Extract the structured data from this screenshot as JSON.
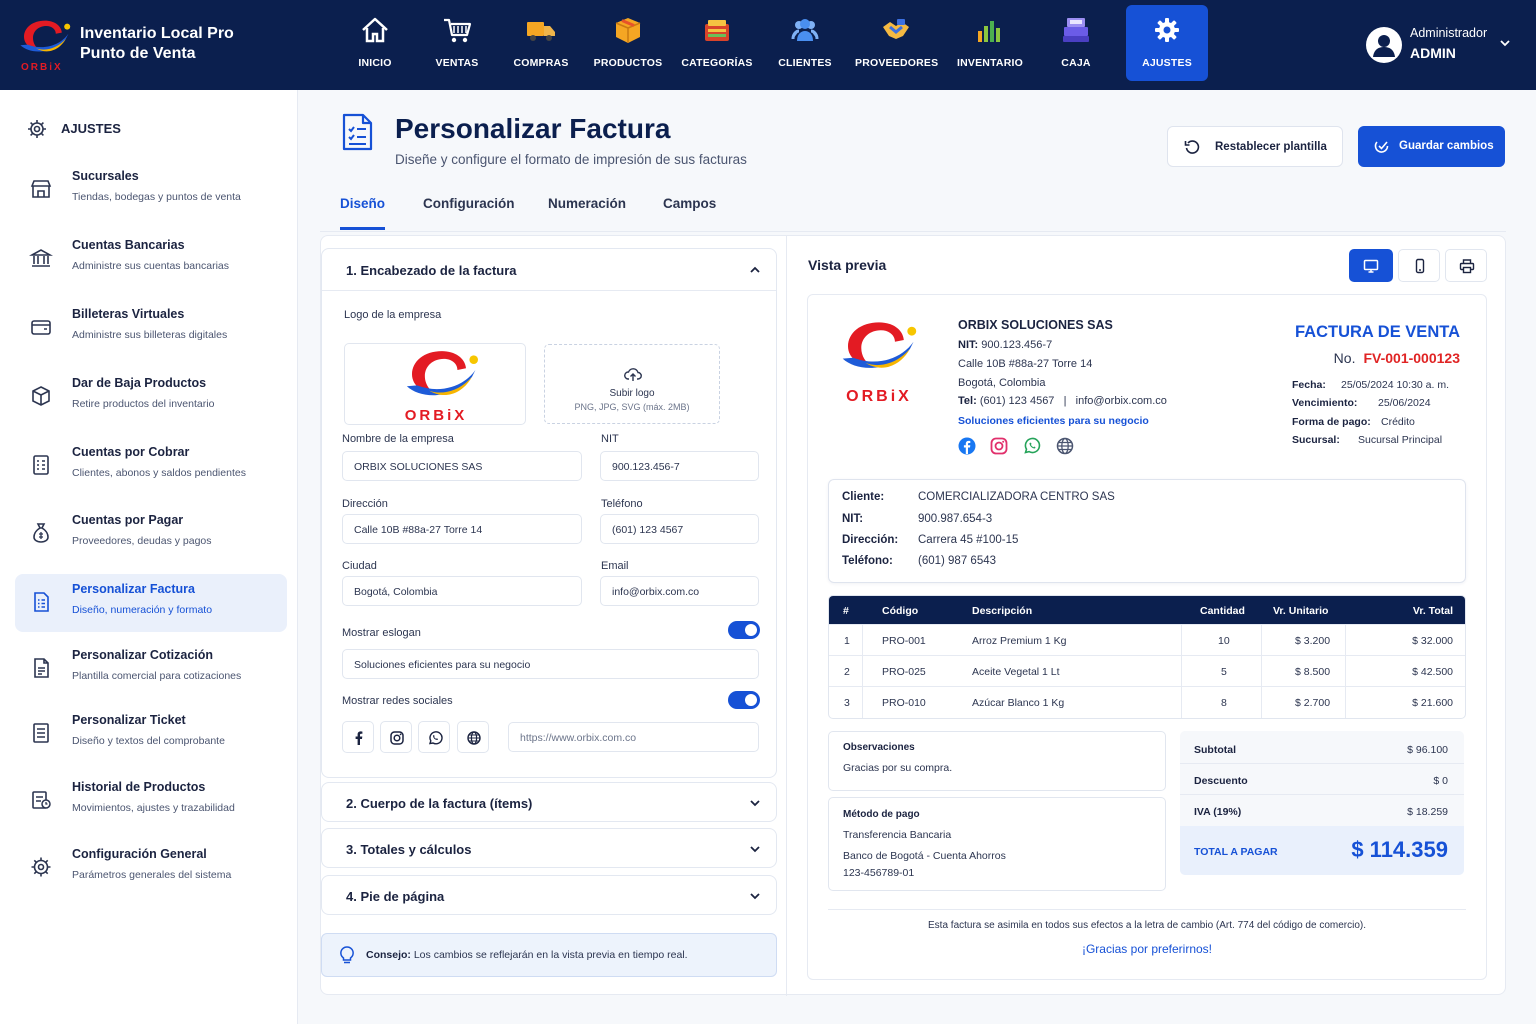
{
  "app": {
    "title_line1": "Inventario Local Pro",
    "title_line2": "Punto de Venta",
    "logo_text": "ORBiX"
  },
  "nav": [
    {
      "label": "INICIO",
      "icon": "home-icon"
    },
    {
      "label": "VENTAS",
      "icon": "cart-icon"
    },
    {
      "label": "COMPRAS",
      "icon": "truck-icon"
    },
    {
      "label": "PRODUCTOS",
      "icon": "box-icon"
    },
    {
      "label": "CATEGORÍAS",
      "icon": "category-icon"
    },
    {
      "label": "CLIENTES",
      "icon": "users-icon"
    },
    {
      "label": "PROVEEDORES",
      "icon": "handshake-icon"
    },
    {
      "label": "INVENTARIO",
      "icon": "bar-chart-icon"
    },
    {
      "label": "CAJA",
      "icon": "cash-register-icon"
    },
    {
      "label": "AJUSTES",
      "icon": "gear-icon",
      "active": true
    }
  ],
  "user": {
    "role": "Administrador",
    "name": "ADMIN"
  },
  "sidebar": {
    "heading": "AJUSTES",
    "items": [
      {
        "title": "Sucursales",
        "desc": "Tiendas, bodegas y puntos de venta",
        "icon": "store-icon"
      },
      {
        "title": "Cuentas Bancarias",
        "desc": "Administre sus cuentas bancarias",
        "icon": "bank-icon"
      },
      {
        "title": "Billeteras Virtuales",
        "desc": "Administre sus billeteras digitales",
        "icon": "wallet-icon"
      },
      {
        "title": "Dar de Baja Productos",
        "desc": "Retire productos del inventario",
        "icon": "box-out-icon"
      },
      {
        "title": "Cuentas por Cobrar",
        "desc": "Clientes, abonos y saldos pendientes",
        "icon": "receivable-icon"
      },
      {
        "title": "Cuentas por Pagar",
        "desc": "Proveedores, deudas y pagos",
        "icon": "money-bag-icon"
      },
      {
        "title": "Personalizar Factura",
        "desc": "Diseño, numeración y formato",
        "icon": "invoice-icon",
        "active": true
      },
      {
        "title": "Personalizar Cotización",
        "desc": "Plantilla comercial para cotizaciones",
        "icon": "quote-icon"
      },
      {
        "title": "Personalizar Ticket",
        "desc": "Diseño y textos del comprobante",
        "icon": "ticket-icon"
      },
      {
        "title": "Historial de Productos",
        "desc": "Movimientos, ajustes y trazabilidad",
        "icon": "history-icon"
      },
      {
        "title": "Configuración General",
        "desc": "Parámetros generales del sistema",
        "icon": "gear-icon"
      }
    ]
  },
  "page": {
    "title": "Personalizar Factura",
    "subtitle": "Diseñe y configure el formato de impresión de sus facturas",
    "reset_label": "Restablecer plantilla",
    "save_label": "Guardar cambios",
    "tabs": [
      "Diseño",
      "Configuración",
      "Numeración",
      "Campos"
    ]
  },
  "editor": {
    "section1": "1. Encabezado de la factura",
    "logo_label": "Logo de la empresa",
    "upload_title": "Subir logo",
    "upload_hint": "PNG, JPG, SVG (máx. 2MB)",
    "company_label": "Nombre de la empresa",
    "company_value": "ORBIX SOLUCIONES SAS",
    "nit_label": "NIT",
    "nit_value": "900.123.456-7",
    "address_label": "Dirección",
    "address_value": "Calle 10B #88a-27 Torre 14",
    "phone_label": "Teléfono",
    "phone_value": "(601) 123 4567",
    "city_label": "Ciudad",
    "city_value": "Bogotá, Colombia",
    "email_label": "Email",
    "email_value": "info@orbix.com.co",
    "slogan_label": "Mostrar eslogan",
    "slogan_value": "Soluciones eficientes para su negocio",
    "social_label": "Mostrar redes sociales",
    "website_value": "https://www.orbix.com.co",
    "section2": "2. Cuerpo de la factura (ítems)",
    "section3": "3. Totales y cálculos",
    "section4": "4. Pie de página",
    "tip_strong": "Consejo:",
    "tip_text": "Los cambios se reflejarán en la vista previa en tiempo real."
  },
  "preview": {
    "title": "Vista previa",
    "company": "ORBIX SOLUCIONES SAS",
    "nit_key": "NIT:",
    "nit": "900.123.456-7",
    "address": "Calle 10B #88a-27 Torre 14",
    "city": "Bogotá, Colombia",
    "tel_key": "Tel:",
    "tel": "(601) 123 4567",
    "sep": "|",
    "email": "info@orbix.com.co",
    "slogan": "Soluciones eficientes para su negocio",
    "doc_type": "FACTURA DE VENTA",
    "no_label": "No.",
    "number": "FV-001-000123",
    "meta": [
      {
        "k": "Fecha:",
        "v": "25/05/2024 10:30 a. m."
      },
      {
        "k": "Vencimiento:",
        "v": "25/06/2024"
      },
      {
        "k": "Forma de pago:",
        "v": "Crédito"
      },
      {
        "k": "Sucursal:",
        "v": "Sucursal Principal"
      }
    ],
    "client": [
      {
        "k": "Cliente:",
        "v": "COMERCIALIZADORA CENTRO SAS"
      },
      {
        "k": "NIT:",
        "v": "900.987.654-3"
      },
      {
        "k": "Dirección:",
        "v": "Carrera 45 #100-15"
      },
      {
        "k": "Teléfono:",
        "v": "(601) 987 6543"
      }
    ],
    "table": {
      "headers": [
        "#",
        "Código",
        "Descripción",
        "Cantidad",
        "Vr. Unitario",
        "Vr. Total"
      ],
      "rows": [
        [
          "1",
          "PRO-001",
          "Arroz Premium 1 Kg",
          "10",
          "$ 3.200",
          "$ 32.000"
        ],
        [
          "2",
          "PRO-025",
          "Aceite Vegetal 1 Lt",
          "5",
          "$ 8.500",
          "$ 42.500"
        ],
        [
          "3",
          "PRO-010",
          "Azúcar Blanco 1 Kg",
          "8",
          "$ 2.700",
          "$ 21.600"
        ]
      ]
    },
    "obs_label": "Observaciones",
    "obs_text": "Gracias por su compra.",
    "pay_label": "Método de pago",
    "pay_line1": "Transferencia Bancaria",
    "pay_line2": "Banco de Bogotá - Cuenta Ahorros",
    "pay_line3": "123-456789-01",
    "totals": [
      {
        "k": "Subtotal",
        "v": "$ 96.100"
      },
      {
        "k": "Descuento",
        "v": "$ 0"
      },
      {
        "k": "IVA (19%)",
        "v": "$ 18.259"
      }
    ],
    "grand_label": "TOTAL A PAGAR",
    "grand_value": "$ 114.359",
    "legal": "Esta factura se asimila en todos sus efectos a la letra de cambio (Art. 774 del código de comercio).",
    "thanks": "¡Gracias por preferirnos!"
  },
  "colors": {
    "navy": "#0b1f4e",
    "accent": "#1651d6",
    "invoice_number": "#e02424"
  }
}
